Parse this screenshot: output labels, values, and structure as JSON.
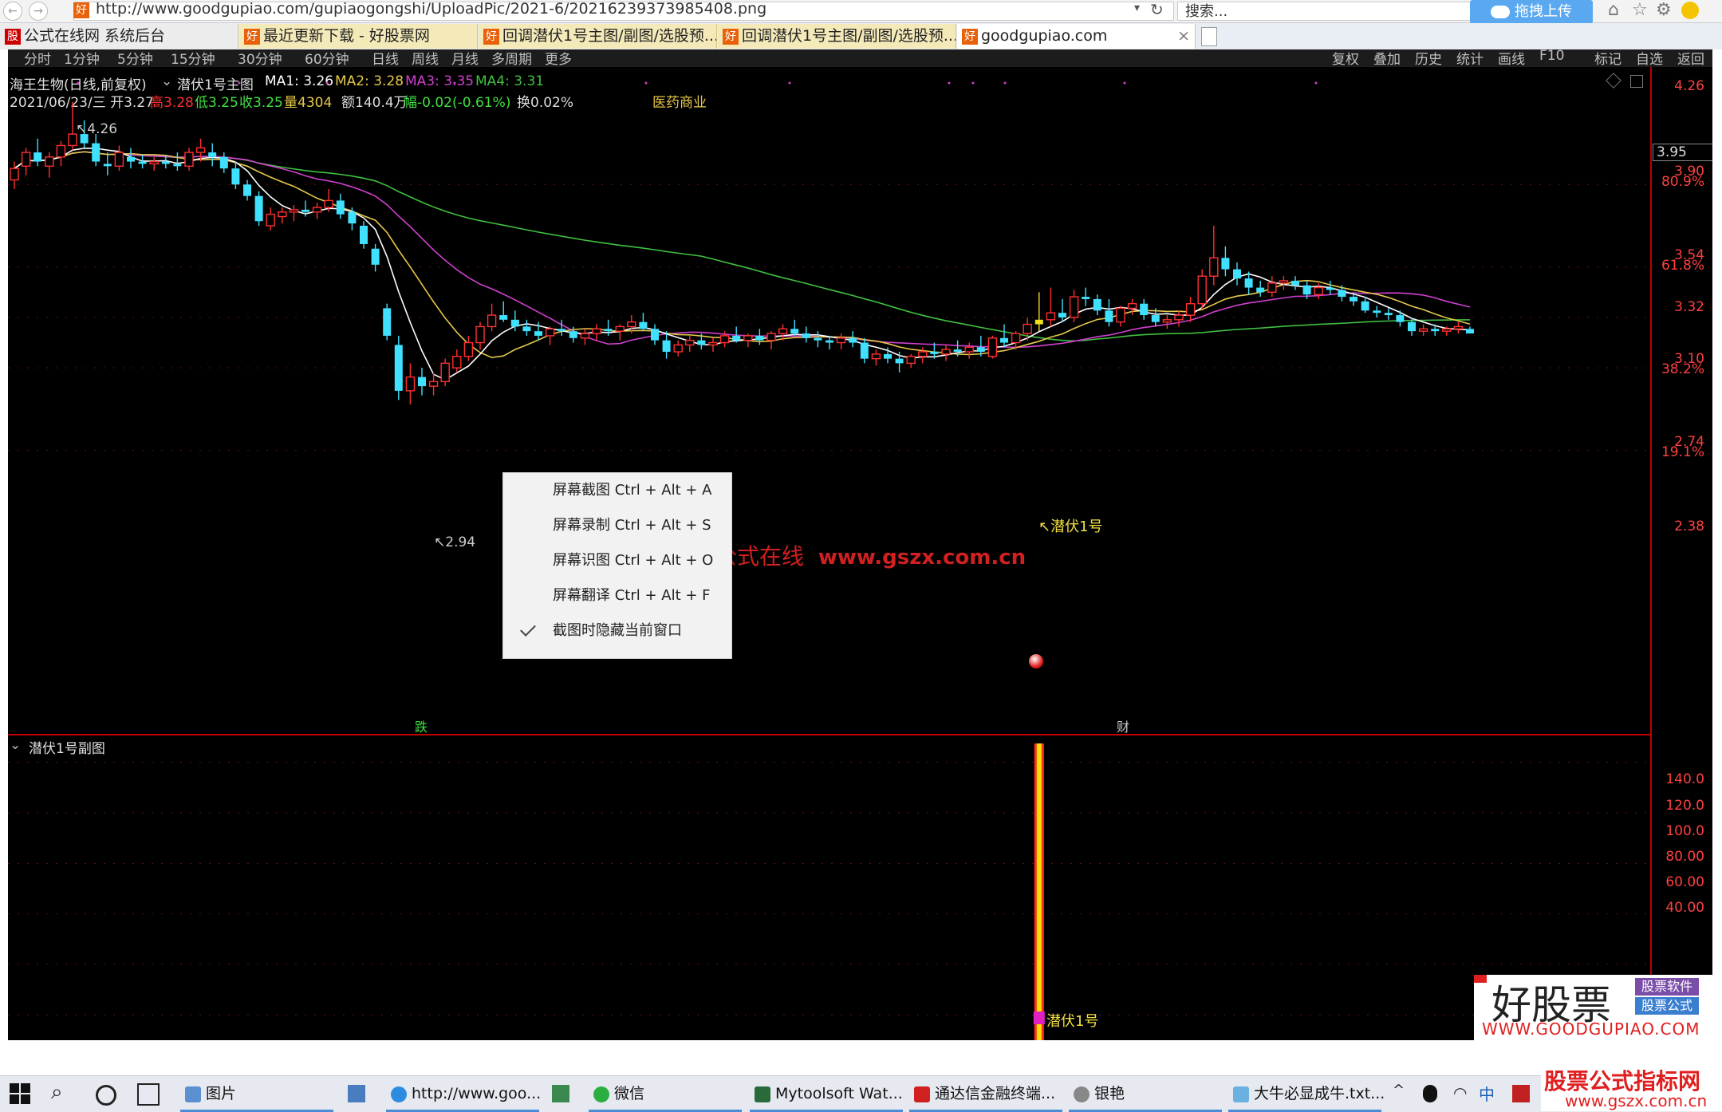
{
  "browser": {
    "url": "http://www.goodgupiao.com/gupiaogongshi/UploadPic/2021-6/20216239373985408.png",
    "search_placeholder": "搜索...",
    "upload_label": "拖拽上传",
    "tabs": [
      {
        "label": "公式在线网 系统后台",
        "icon": "股"
      },
      {
        "label": "最近更新下载 - 好股票网",
        "icon": "好"
      },
      {
        "label": "回调潜伏1号主图/副图/选股预...",
        "icon": "好"
      },
      {
        "label": "回调潜伏1号主图/副图/选股预...",
        "icon": "好"
      },
      {
        "label": "goodgupiao.com",
        "icon": "好"
      }
    ]
  },
  "chart_header": {
    "menu_left": [
      "分时",
      "1分钟",
      "5分钟",
      "15分钟",
      "30分钟",
      "60分钟",
      "日线",
      "周线",
      "月线",
      "多周期",
      "更多"
    ],
    "menu_right": [
      "复权",
      "叠加",
      "历史",
      "统计",
      "画线",
      "F10",
      "标记",
      "自选",
      "返回"
    ],
    "stock_title": "海王生物(日线,前复权)",
    "indicator": "潜伏1号主图",
    "ma1_label": "MA1: 3.26",
    "ma2_label": "MA2: 3.28",
    "ma3_label": "MA3: 3.35",
    "ma4_label": "MA4: 3.31",
    "date_open": "2021/06/23/三 开3.27",
    "high": "高3.28",
    "low": "低3.25",
    "close": "收3.25",
    "volume": "量4304",
    "amount": "额140.4万",
    "change": "幅-0.02(-0.61%)",
    "turnover": "换0.02%",
    "sector": "医药商业"
  },
  "main_axis": {
    "labels": [
      "4.26",
      "3.95",
      "3.90",
      "80.9%",
      "3.54",
      "61.8%",
      "3.32",
      "3.10",
      "38.2%",
      "2.74",
      "19.1%",
      "2.38"
    ],
    "highlight": "3.95"
  },
  "annotations": {
    "high_label": "4.26",
    "low_label": "2.94",
    "signal_label": "潜伏1号",
    "watermark_cn": "公式在线",
    "watermark_url": "www.gszx.com.cn",
    "bottom_tag_left": "跌",
    "bottom_tag_right": "财"
  },
  "sub_panel": {
    "title": "潜伏1号副图",
    "axis_labels": [
      "140.0",
      "120.0",
      "100.0",
      "80.00",
      "60.00",
      "40.00"
    ],
    "signal_label": "潜伏1号"
  },
  "context_menu": {
    "items": [
      {
        "label": "屏幕截图 Ctrl + Alt + A"
      },
      {
        "label": "屏幕录制 Ctrl + Alt + S"
      },
      {
        "label": "屏幕识图 Ctrl + Alt + O"
      },
      {
        "label": "屏幕翻译 Ctrl + Alt + F"
      },
      {
        "label": "截图时隐藏当前窗口",
        "checked": true
      }
    ]
  },
  "logo": {
    "name": "好股票",
    "tag1": "股票软件",
    "tag2": "股票公式",
    "url": "WWW.GOODGUPIAO.COM"
  },
  "taskbar": {
    "items": [
      "图片",
      "http://www.goo...",
      "微信",
      "Mytoolsoft Wat...",
      "通达信金融终端...",
      "银艳",
      "大牛必显成牛.txt..."
    ],
    "ime": "中"
  },
  "corner_watermark": {
    "line1": "股票公式指标网",
    "line2": "www.gszx.com.cn"
  },
  "colors": {
    "ma1": "#ffffff",
    "ma2": "#e6c84a",
    "ma3": "#d040d0",
    "ma4": "#40c040",
    "up": "#ff3030",
    "down": "#40e0ff",
    "axis": "#ff4040"
  },
  "chart_data": {
    "type": "candlestick",
    "title": "海王生物(日线,前复权)",
    "ylim": [
      2.38,
      4.35
    ],
    "candles": [
      {
        "o": 3.92,
        "h": 4.0,
        "l": 3.88,
        "c": 3.97
      },
      {
        "o": 3.98,
        "h": 4.06,
        "l": 3.94,
        "c": 4.04
      },
      {
        "o": 4.04,
        "h": 4.1,
        "l": 3.98,
        "c": 4.0
      },
      {
        "o": 3.98,
        "h": 4.04,
        "l": 3.93,
        "c": 4.02
      },
      {
        "o": 4.02,
        "h": 4.09,
        "l": 3.98,
        "c": 4.07
      },
      {
        "o": 4.07,
        "h": 4.26,
        "l": 4.05,
        "c": 4.12
      },
      {
        "o": 4.12,
        "h": 4.18,
        "l": 4.06,
        "c": 4.08
      },
      {
        "o": 4.08,
        "h": 4.12,
        "l": 3.98,
        "c": 4.0
      },
      {
        "o": 3.99,
        "h": 4.04,
        "l": 3.94,
        "c": 3.98
      },
      {
        "o": 3.98,
        "h": 4.07,
        "l": 3.96,
        "c": 4.04
      },
      {
        "o": 4.02,
        "h": 4.06,
        "l": 3.97,
        "c": 4.0
      },
      {
        "o": 4.0,
        "h": 4.03,
        "l": 3.97,
        "c": 3.99
      },
      {
        "o": 3.99,
        "h": 4.02,
        "l": 3.96,
        "c": 4.0
      },
      {
        "o": 4.0,
        "h": 4.03,
        "l": 3.97,
        "c": 3.99
      },
      {
        "o": 3.99,
        "h": 4.04,
        "l": 3.96,
        "c": 3.98
      },
      {
        "o": 3.98,
        "h": 4.06,
        "l": 3.96,
        "c": 4.04
      },
      {
        "o": 4.04,
        "h": 4.1,
        "l": 4.0,
        "c": 4.06
      },
      {
        "o": 4.04,
        "h": 4.08,
        "l": 3.98,
        "c": 4.02
      },
      {
        "o": 4.02,
        "h": 4.04,
        "l": 3.95,
        "c": 3.97
      },
      {
        "o": 3.97,
        "h": 4.0,
        "l": 3.88,
        "c": 3.9
      },
      {
        "o": 3.9,
        "h": 3.92,
        "l": 3.83,
        "c": 3.85
      },
      {
        "o": 3.85,
        "h": 3.87,
        "l": 3.72,
        "c": 3.74
      },
      {
        "o": 3.72,
        "h": 3.8,
        "l": 3.7,
        "c": 3.77
      },
      {
        "o": 3.76,
        "h": 3.8,
        "l": 3.73,
        "c": 3.78
      },
      {
        "o": 3.78,
        "h": 3.81,
        "l": 3.74,
        "c": 3.79
      },
      {
        "o": 3.79,
        "h": 3.83,
        "l": 3.76,
        "c": 3.78
      },
      {
        "o": 3.78,
        "h": 3.82,
        "l": 3.75,
        "c": 3.8
      },
      {
        "o": 3.8,
        "h": 3.88,
        "l": 3.78,
        "c": 3.83
      },
      {
        "o": 3.83,
        "h": 3.86,
        "l": 3.75,
        "c": 3.77
      },
      {
        "o": 3.78,
        "h": 3.8,
        "l": 3.7,
        "c": 3.73
      },
      {
        "o": 3.72,
        "h": 3.74,
        "l": 3.62,
        "c": 3.64
      },
      {
        "o": 3.62,
        "h": 3.64,
        "l": 3.52,
        "c": 3.55
      },
      {
        "o": 3.36,
        "h": 3.38,
        "l": 3.22,
        "c": 3.24
      },
      {
        "o": 3.2,
        "h": 3.24,
        "l": 2.96,
        "c": 3.0
      },
      {
        "o": 3.0,
        "h": 3.12,
        "l": 2.94,
        "c": 3.06
      },
      {
        "o": 3.06,
        "h": 3.1,
        "l": 2.98,
        "c": 3.02
      },
      {
        "o": 3.02,
        "h": 3.08,
        "l": 2.98,
        "c": 3.04
      },
      {
        "o": 3.04,
        "h": 3.14,
        "l": 3.02,
        "c": 3.12
      },
      {
        "o": 3.1,
        "h": 3.18,
        "l": 3.08,
        "c": 3.15
      },
      {
        "o": 3.15,
        "h": 3.24,
        "l": 3.13,
        "c": 3.21
      },
      {
        "o": 3.21,
        "h": 3.3,
        "l": 3.18,
        "c": 3.28
      },
      {
        "o": 3.28,
        "h": 3.38,
        "l": 3.26,
        "c": 3.33
      },
      {
        "o": 3.33,
        "h": 3.39,
        "l": 3.3,
        "c": 3.31
      },
      {
        "o": 3.31,
        "h": 3.35,
        "l": 3.26,
        "c": 3.28
      },
      {
        "o": 3.28,
        "h": 3.31,
        "l": 3.24,
        "c": 3.26
      },
      {
        "o": 3.26,
        "h": 3.3,
        "l": 3.22,
        "c": 3.24
      },
      {
        "o": 3.24,
        "h": 3.28,
        "l": 3.2,
        "c": 3.27
      },
      {
        "o": 3.27,
        "h": 3.31,
        "l": 3.24,
        "c": 3.26
      },
      {
        "o": 3.26,
        "h": 3.28,
        "l": 3.21,
        "c": 3.23
      },
      {
        "o": 3.23,
        "h": 3.27,
        "l": 3.2,
        "c": 3.25
      },
      {
        "o": 3.25,
        "h": 3.29,
        "l": 3.22,
        "c": 3.27
      },
      {
        "o": 3.27,
        "h": 3.31,
        "l": 3.24,
        "c": 3.26
      },
      {
        "o": 3.26,
        "h": 3.29,
        "l": 3.22,
        "c": 3.28
      },
      {
        "o": 3.28,
        "h": 3.33,
        "l": 3.25,
        "c": 3.3
      },
      {
        "o": 3.3,
        "h": 3.34,
        "l": 3.26,
        "c": 3.27
      },
      {
        "o": 3.27,
        "h": 3.29,
        "l": 3.2,
        "c": 3.22
      },
      {
        "o": 3.22,
        "h": 3.26,
        "l": 3.14,
        "c": 3.17
      },
      {
        "o": 3.17,
        "h": 3.22,
        "l": 3.15,
        "c": 3.2
      },
      {
        "o": 3.2,
        "h": 3.24,
        "l": 3.17,
        "c": 3.22
      },
      {
        "o": 3.22,
        "h": 3.25,
        "l": 3.18,
        "c": 3.2
      },
      {
        "o": 3.2,
        "h": 3.23,
        "l": 3.17,
        "c": 3.21
      },
      {
        "o": 3.21,
        "h": 3.26,
        "l": 3.19,
        "c": 3.24
      },
      {
        "o": 3.24,
        "h": 3.28,
        "l": 3.21,
        "c": 3.22
      },
      {
        "o": 3.22,
        "h": 3.25,
        "l": 3.19,
        "c": 3.24
      },
      {
        "o": 3.24,
        "h": 3.27,
        "l": 3.2,
        "c": 3.22
      },
      {
        "o": 3.22,
        "h": 3.26,
        "l": 3.18,
        "c": 3.25
      },
      {
        "o": 3.25,
        "h": 3.29,
        "l": 3.22,
        "c": 3.27
      },
      {
        "o": 3.27,
        "h": 3.31,
        "l": 3.24,
        "c": 3.25
      },
      {
        "o": 3.25,
        "h": 3.28,
        "l": 3.21,
        "c": 3.23
      },
      {
        "o": 3.23,
        "h": 3.26,
        "l": 3.19,
        "c": 3.22
      },
      {
        "o": 3.22,
        "h": 3.24,
        "l": 3.18,
        "c": 3.21
      },
      {
        "o": 3.21,
        "h": 3.25,
        "l": 3.18,
        "c": 3.23
      },
      {
        "o": 3.23,
        "h": 3.26,
        "l": 3.19,
        "c": 3.21
      },
      {
        "o": 3.21,
        "h": 3.23,
        "l": 3.12,
        "c": 3.14
      },
      {
        "o": 3.14,
        "h": 3.18,
        "l": 3.11,
        "c": 3.16
      },
      {
        "o": 3.16,
        "h": 3.19,
        "l": 3.12,
        "c": 3.14
      },
      {
        "o": 3.14,
        "h": 3.17,
        "l": 3.08,
        "c": 3.12
      },
      {
        "o": 3.12,
        "h": 3.16,
        "l": 3.1,
        "c": 3.15
      },
      {
        "o": 3.15,
        "h": 3.19,
        "l": 3.12,
        "c": 3.17
      },
      {
        "o": 3.17,
        "h": 3.21,
        "l": 3.14,
        "c": 3.16
      },
      {
        "o": 3.16,
        "h": 3.2,
        "l": 3.13,
        "c": 3.18
      },
      {
        "o": 3.18,
        "h": 3.22,
        "l": 3.15,
        "c": 3.17
      },
      {
        "o": 3.17,
        "h": 3.21,
        "l": 3.14,
        "c": 3.19
      },
      {
        "o": 3.19,
        "h": 3.24,
        "l": 3.15,
        "c": 3.17
      },
      {
        "o": 3.15,
        "h": 3.24,
        "l": 3.14,
        "c": 3.23
      },
      {
        "o": 3.23,
        "h": 3.29,
        "l": 3.19,
        "c": 3.21
      },
      {
        "o": 3.21,
        "h": 3.26,
        "l": 3.18,
        "c": 3.25
      },
      {
        "o": 3.25,
        "h": 3.32,
        "l": 3.22,
        "c": 3.29
      },
      {
        "o": 3.29,
        "h": 3.43,
        "l": 3.26,
        "c": 3.31
      },
      {
        "o": 3.31,
        "h": 3.45,
        "l": 3.28,
        "c": 3.34
      },
      {
        "o": 3.34,
        "h": 3.4,
        "l": 3.3,
        "c": 3.32
      },
      {
        "o": 3.32,
        "h": 3.44,
        "l": 3.3,
        "c": 3.41
      },
      {
        "o": 3.41,
        "h": 3.45,
        "l": 3.37,
        "c": 3.4
      },
      {
        "o": 3.4,
        "h": 3.42,
        "l": 3.33,
        "c": 3.35
      },
      {
        "o": 3.35,
        "h": 3.4,
        "l": 3.28,
        "c": 3.3
      },
      {
        "o": 3.3,
        "h": 3.37,
        "l": 3.28,
        "c": 3.36
      },
      {
        "o": 3.36,
        "h": 3.4,
        "l": 3.33,
        "c": 3.38
      },
      {
        "o": 3.38,
        "h": 3.4,
        "l": 3.31,
        "c": 3.33
      },
      {
        "o": 3.33,
        "h": 3.36,
        "l": 3.28,
        "c": 3.3
      },
      {
        "o": 3.3,
        "h": 3.33,
        "l": 3.27,
        "c": 3.31
      },
      {
        "o": 3.31,
        "h": 3.35,
        "l": 3.28,
        "c": 3.33
      },
      {
        "o": 3.33,
        "h": 3.41,
        "l": 3.3,
        "c": 3.38
      },
      {
        "o": 3.38,
        "h": 3.53,
        "l": 3.36,
        "c": 3.5
      },
      {
        "o": 3.5,
        "h": 3.72,
        "l": 3.46,
        "c": 3.58
      },
      {
        "o": 3.58,
        "h": 3.63,
        "l": 3.5,
        "c": 3.53
      },
      {
        "o": 3.53,
        "h": 3.56,
        "l": 3.46,
        "c": 3.49
      },
      {
        "o": 3.49,
        "h": 3.52,
        "l": 3.42,
        "c": 3.45
      },
      {
        "o": 3.45,
        "h": 3.48,
        "l": 3.41,
        "c": 3.43
      },
      {
        "o": 3.43,
        "h": 3.5,
        "l": 3.41,
        "c": 3.47
      },
      {
        "o": 3.47,
        "h": 3.5,
        "l": 3.44,
        "c": 3.48
      },
      {
        "o": 3.48,
        "h": 3.5,
        "l": 3.44,
        "c": 3.46
      },
      {
        "o": 3.46,
        "h": 3.48,
        "l": 3.4,
        "c": 3.42
      },
      {
        "o": 3.42,
        "h": 3.47,
        "l": 3.4,
        "c": 3.45
      },
      {
        "o": 3.45,
        "h": 3.48,
        "l": 3.42,
        "c": 3.44
      },
      {
        "o": 3.44,
        "h": 3.46,
        "l": 3.39,
        "c": 3.41
      },
      {
        "o": 3.41,
        "h": 3.43,
        "l": 3.37,
        "c": 3.39
      },
      {
        "o": 3.39,
        "h": 3.41,
        "l": 3.34,
        "c": 3.35
      },
      {
        "o": 3.35,
        "h": 3.37,
        "l": 3.32,
        "c": 3.34
      },
      {
        "o": 3.34,
        "h": 3.36,
        "l": 3.31,
        "c": 3.33
      },
      {
        "o": 3.33,
        "h": 3.35,
        "l": 3.28,
        "c": 3.3
      },
      {
        "o": 3.3,
        "h": 3.32,
        "l": 3.24,
        "c": 3.26
      },
      {
        "o": 3.26,
        "h": 3.29,
        "l": 3.24,
        "c": 3.27
      },
      {
        "o": 3.27,
        "h": 3.29,
        "l": 3.24,
        "c": 3.26
      },
      {
        "o": 3.26,
        "h": 3.28,
        "l": 3.24,
        "c": 3.27
      },
      {
        "o": 3.27,
        "h": 3.3,
        "l": 3.25,
        "c": 3.28
      },
      {
        "o": 3.27,
        "h": 3.28,
        "l": 3.25,
        "c": 3.25
      }
    ],
    "signal_index": 88,
    "sub_ylim": [
      30,
      150
    ],
    "sub_signal_value": 150
  }
}
